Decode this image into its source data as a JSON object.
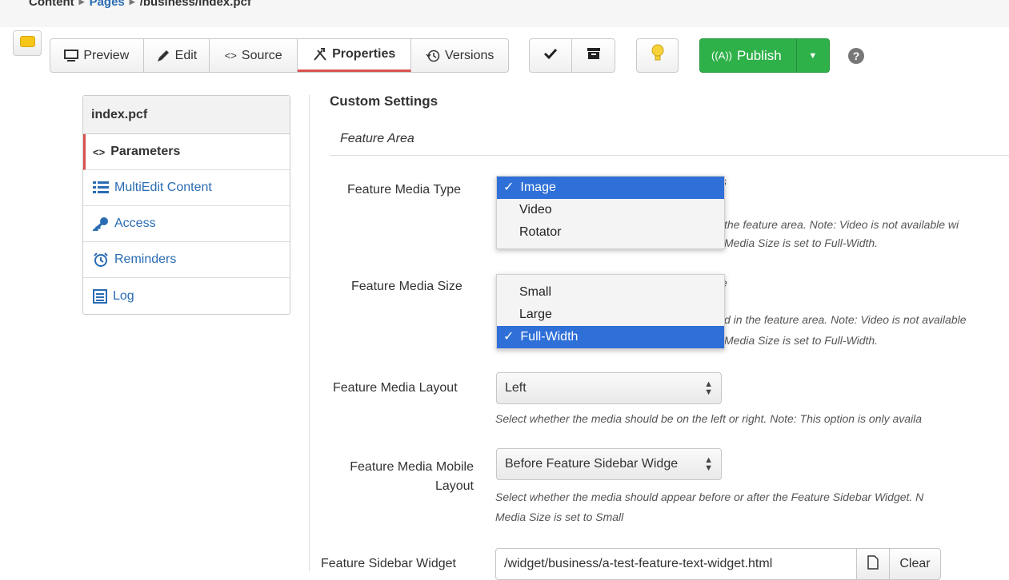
{
  "breadcrumb": {
    "root": "Content",
    "pages": "Pages",
    "path": "/business/index.pcf"
  },
  "toolbar": {
    "preview": "Preview",
    "edit": "Edit",
    "source": "Source",
    "properties": "Properties",
    "versions": "Versions",
    "publish": "Publish",
    "help": "?"
  },
  "sidebar": {
    "title": "index.pcf",
    "items": [
      {
        "label": "Parameters"
      },
      {
        "label": "MultiEdit Content"
      },
      {
        "label": "Access"
      },
      {
        "label": "Reminders"
      },
      {
        "label": "Log"
      }
    ]
  },
  "main": {
    "title": "Custom Settings",
    "section": "Feature Area",
    "fields": {
      "media_type": {
        "label": "Feature Media Type",
        "options": [
          "Image",
          "Video",
          "Rotator"
        ],
        "selected": "Image",
        "help_1": "the feature area. Note: Video is not available wi",
        "help_2": "Media Size is set to Full-Width."
      },
      "media_size": {
        "label": "Feature Media Size",
        "options": [
          "Small",
          "Large",
          "Full-Width"
        ],
        "selected": "Full-Width",
        "help_1": "d in the feature area. Note: Video is not available",
        "help_2": "Media Size is set to Full-Width."
      },
      "media_layout": {
        "label": "Feature Media Layout",
        "value": "Left",
        "help": "Select whether the media should be on the left or right. Note: This option is only availa"
      },
      "mobile_layout": {
        "label_1": "Feature Media Mobile",
        "label_2": "Layout",
        "value": "Before Feature Sidebar Widge",
        "help_1": "Select whether the media should appear before or after the Feature Sidebar Widget. N",
        "help_2": "Media Size is set to Small"
      },
      "sidebar_widget": {
        "label": "Feature Sidebar Widget",
        "value": "/widget/business/a-test-feature-text-widget.html",
        "clear": "Clear"
      }
    }
  }
}
